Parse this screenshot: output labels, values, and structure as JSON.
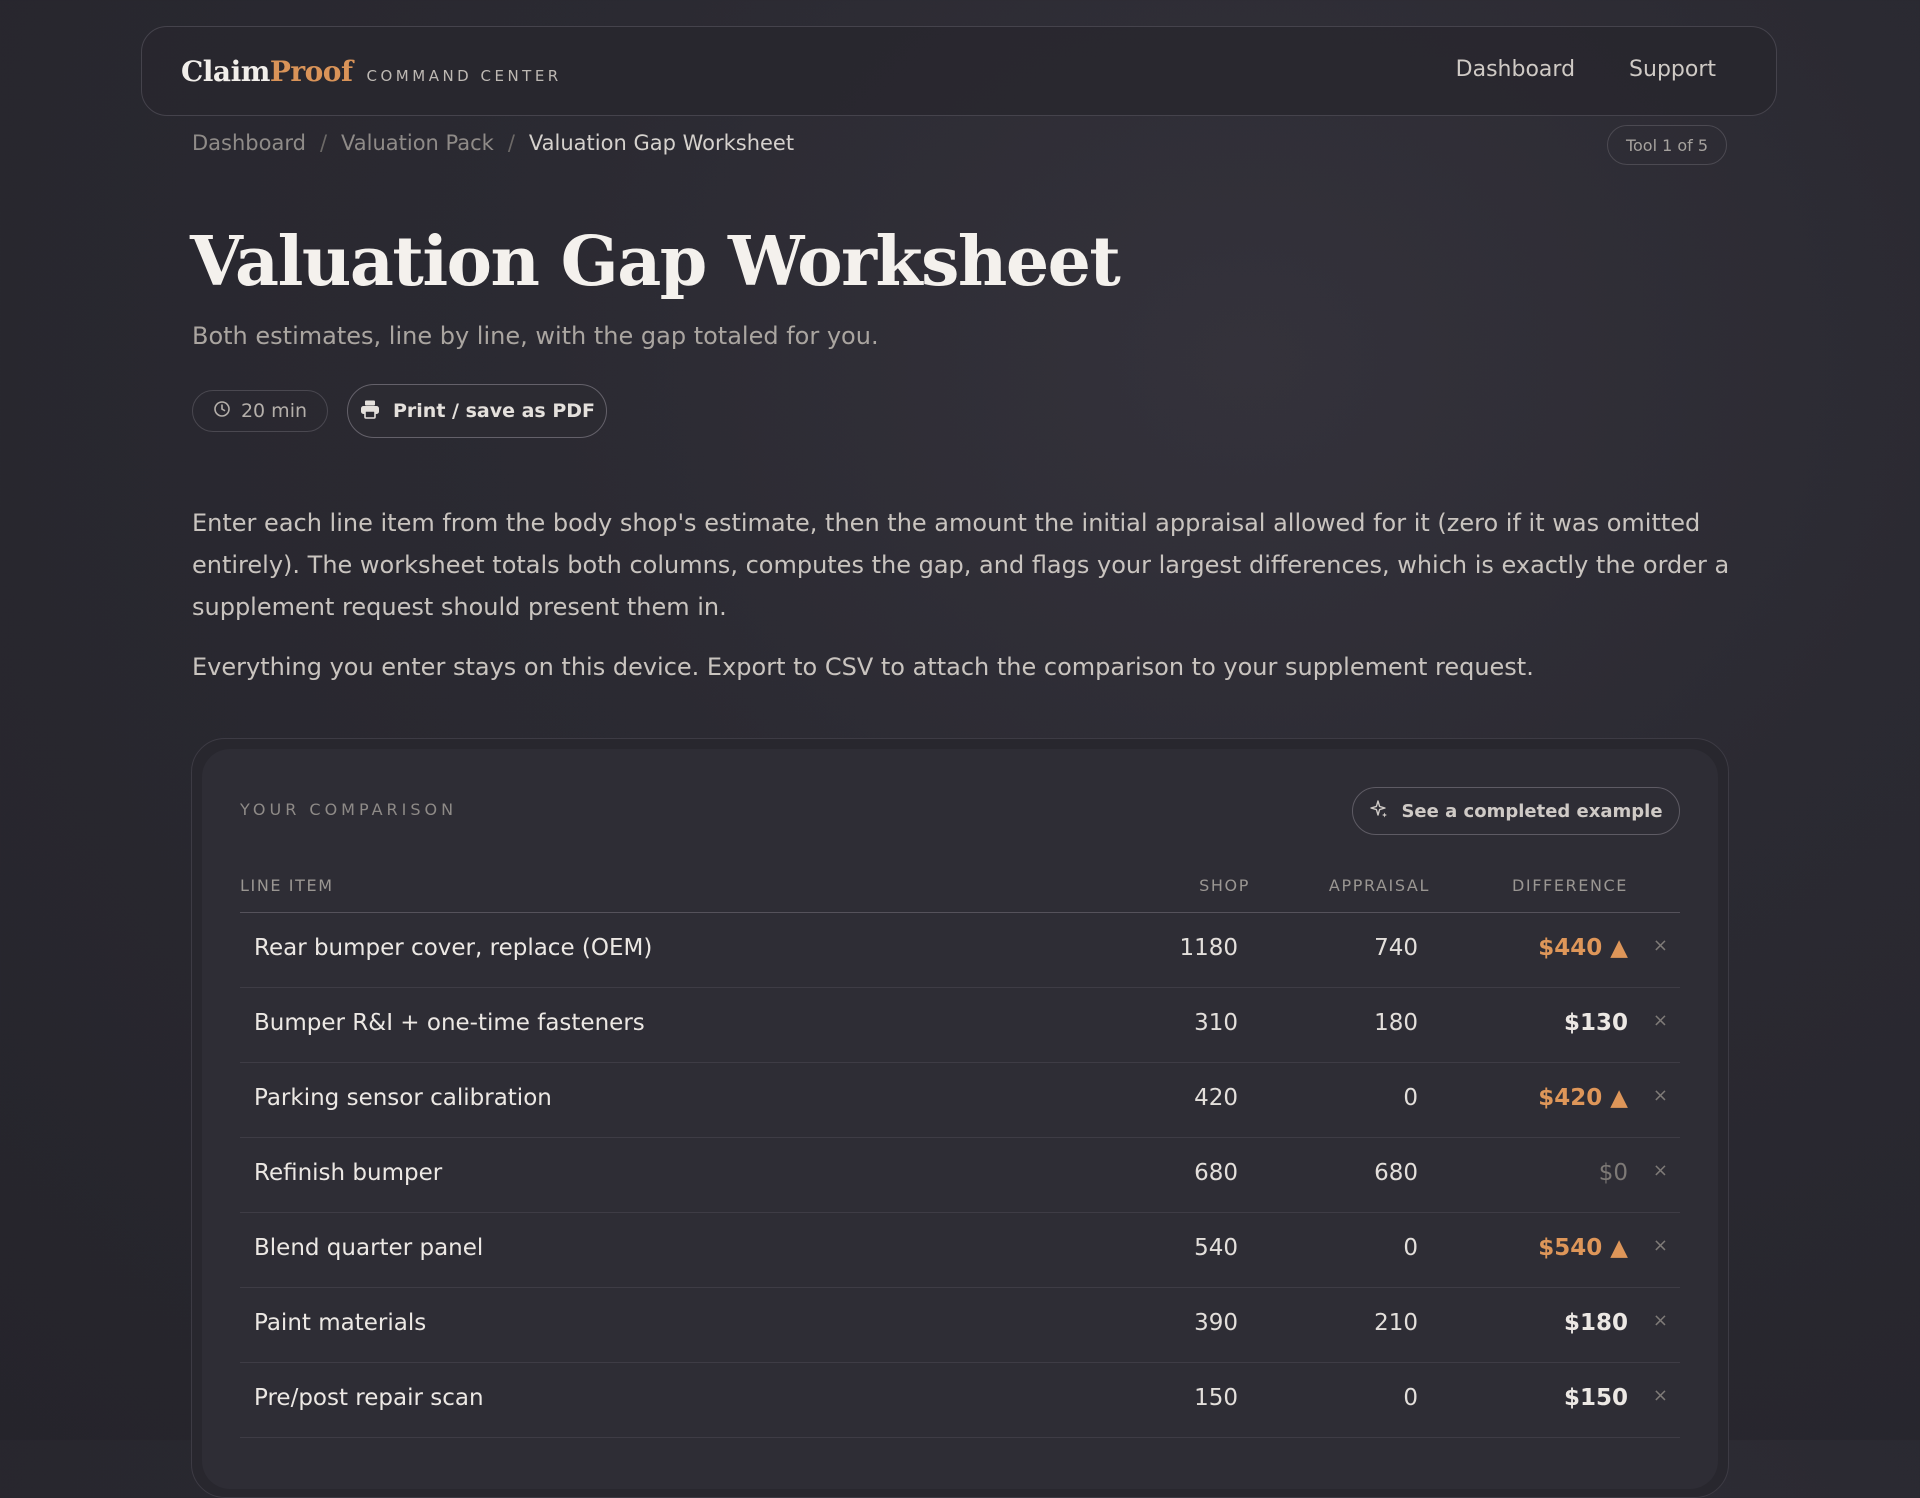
{
  "nav": {
    "brand_claim": "Claim",
    "brand_proof": "Proof",
    "brand_sub": "COMMAND CENTER",
    "links": [
      "Dashboard",
      "Support"
    ]
  },
  "breadcrumb": [
    "Dashboard",
    "Valuation Pack",
    "Valuation Gap Worksheet"
  ],
  "tool_counter": "Tool 1 of 5",
  "page": {
    "title": "Valuation Gap Worksheet",
    "subtitle": "Both estimates, line by line, with the gap totaled for you.",
    "time": "20 min",
    "print_label": "Print / save as PDF",
    "intro": "Enter each line item from the body shop's estimate, then the amount the initial appraisal allowed for it (zero if it was omitted entirely). The worksheet totals both columns, computes the gap, and flags your largest differences, which is exactly the order a supplement request should present them in.",
    "intro2": "Everything you enter stays on this device. Export to CSV to attach the comparison to your supplement request."
  },
  "comparison": {
    "label": "YOUR COMPARISON",
    "example_label": "See a completed example",
    "columns": [
      "LINE ITEM",
      "SHOP",
      "APPRAISAL",
      "DIFFERENCE"
    ],
    "delete_glyph": "×",
    "rows": [
      {
        "item": "Rear bumper cover, replace (OEM)",
        "shop": "1180",
        "appraisal": "740",
        "diff": "$440 ▲",
        "flag": "high"
      },
      {
        "item": "Bumper R&I + one-time fasteners",
        "shop": "310",
        "appraisal": "180",
        "diff": "$130",
        "flag": "normal"
      },
      {
        "item": "Parking sensor calibration",
        "shop": "420",
        "appraisal": "0",
        "diff": "$420 ▲",
        "flag": "high"
      },
      {
        "item": "Refinish bumper",
        "shop": "680",
        "appraisal": "680",
        "diff": "$0",
        "flag": "zero"
      },
      {
        "item": "Blend quarter panel",
        "shop": "540",
        "appraisal": "0",
        "diff": "$540 ▲",
        "flag": "high"
      },
      {
        "item": "Paint materials",
        "shop": "390",
        "appraisal": "210",
        "diff": "$180",
        "flag": "normal"
      },
      {
        "item": "Pre/post repair scan",
        "shop": "150",
        "appraisal": "0",
        "diff": "$150",
        "flag": "normal"
      }
    ]
  },
  "colors": {
    "accent": "#d99358",
    "background": "#2b2a32",
    "card": "#2e2d35"
  },
  "icons": [
    "clock-icon",
    "printer-icon",
    "sparkle-icon",
    "close-icon"
  ]
}
